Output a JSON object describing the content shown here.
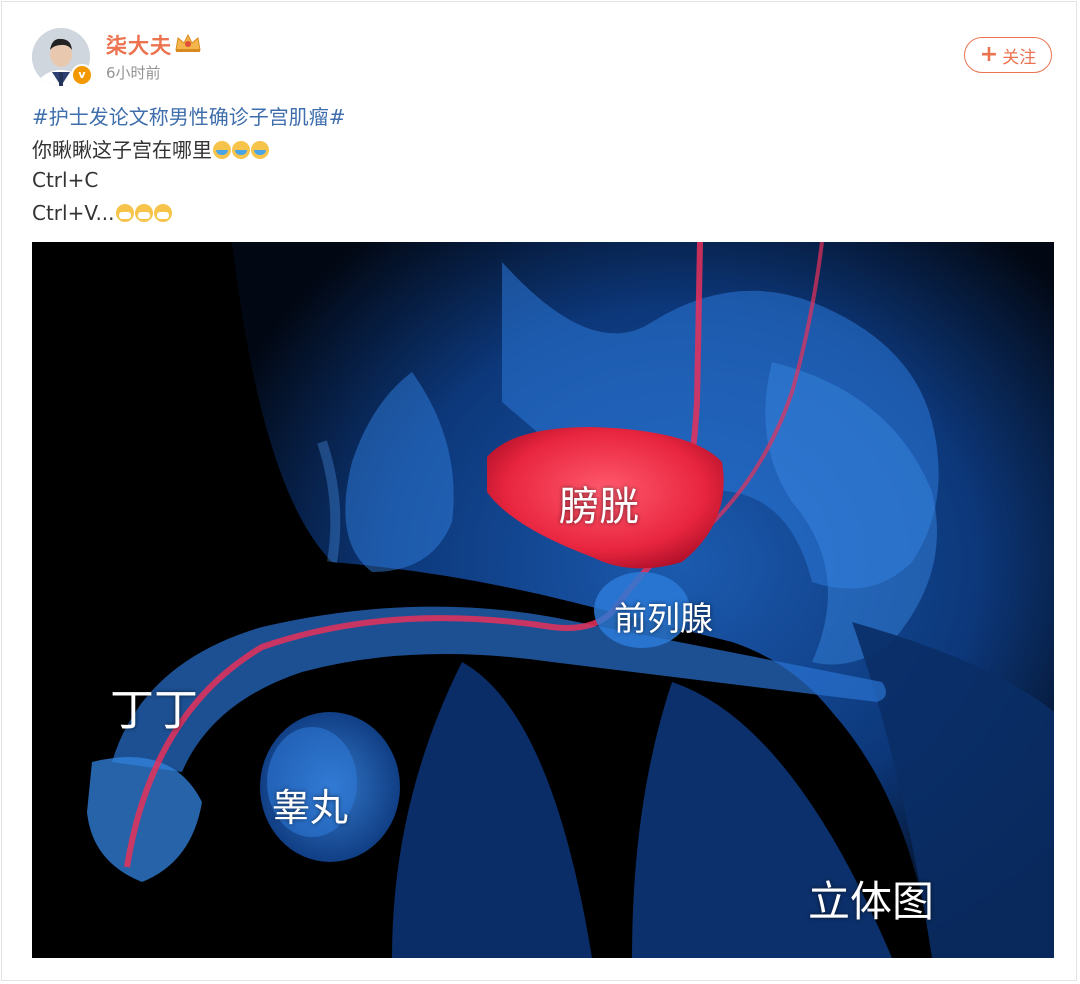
{
  "post": {
    "username": "柒大夫",
    "time": "6小时前",
    "follow_label": "关注",
    "hashtag": "#护士发论文称男性确诊子宫肌瘤#",
    "line1": "你瞅瞅这子宫在哪里",
    "line2": "Ctrl+C",
    "line3": "Ctrl+V..."
  },
  "image": {
    "labels": {
      "bladder": "膀胱",
      "prostate": "前列腺",
      "penis": "丁丁",
      "testis": "睾丸",
      "caption": "立体图"
    }
  },
  "colors": {
    "username": "#eb7350",
    "hashtag": "#3e6eab",
    "follow": "#eb7350"
  }
}
